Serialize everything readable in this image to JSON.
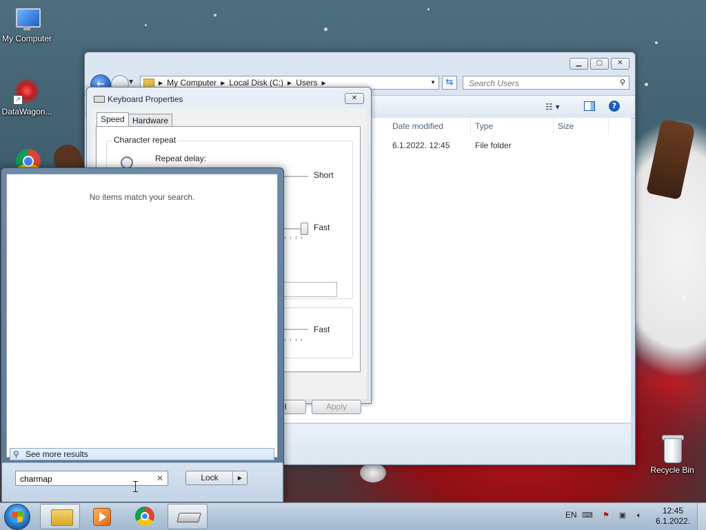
{
  "desktop": {
    "icons": [
      {
        "label": "My Computer"
      },
      {
        "label": "DataWagon..."
      },
      {
        "label": ""
      },
      {
        "label": "Recycle Bin"
      }
    ]
  },
  "explorer": {
    "breadcrumb": [
      "My Computer",
      "Local Disk (C:)",
      "Users"
    ],
    "search_placeholder": "Search Users",
    "columns": [
      "Date modified",
      "Type",
      "Size"
    ],
    "rows": [
      {
        "date": "6.1.2022. 12:45",
        "type": "File folder"
      }
    ]
  },
  "keyboard_dialog": {
    "title": "Keyboard Properties",
    "tabs": [
      "Speed",
      "Hardware"
    ],
    "group_character_repeat": "Character repeat",
    "repeat_delay_label": "Repeat delay:",
    "short_label": "Short",
    "fast_label_1": "Fast",
    "fast_label_2": "Fast",
    "cancel_fragment": "cel",
    "apply_label": "Apply"
  },
  "start_menu": {
    "no_items": "No items match your search.",
    "see_more": "See more results",
    "search_value": "charmap",
    "lock_label": "Lock"
  },
  "taskbar": {
    "lang": "EN",
    "time": "12:45",
    "date": "6.1.2022."
  }
}
